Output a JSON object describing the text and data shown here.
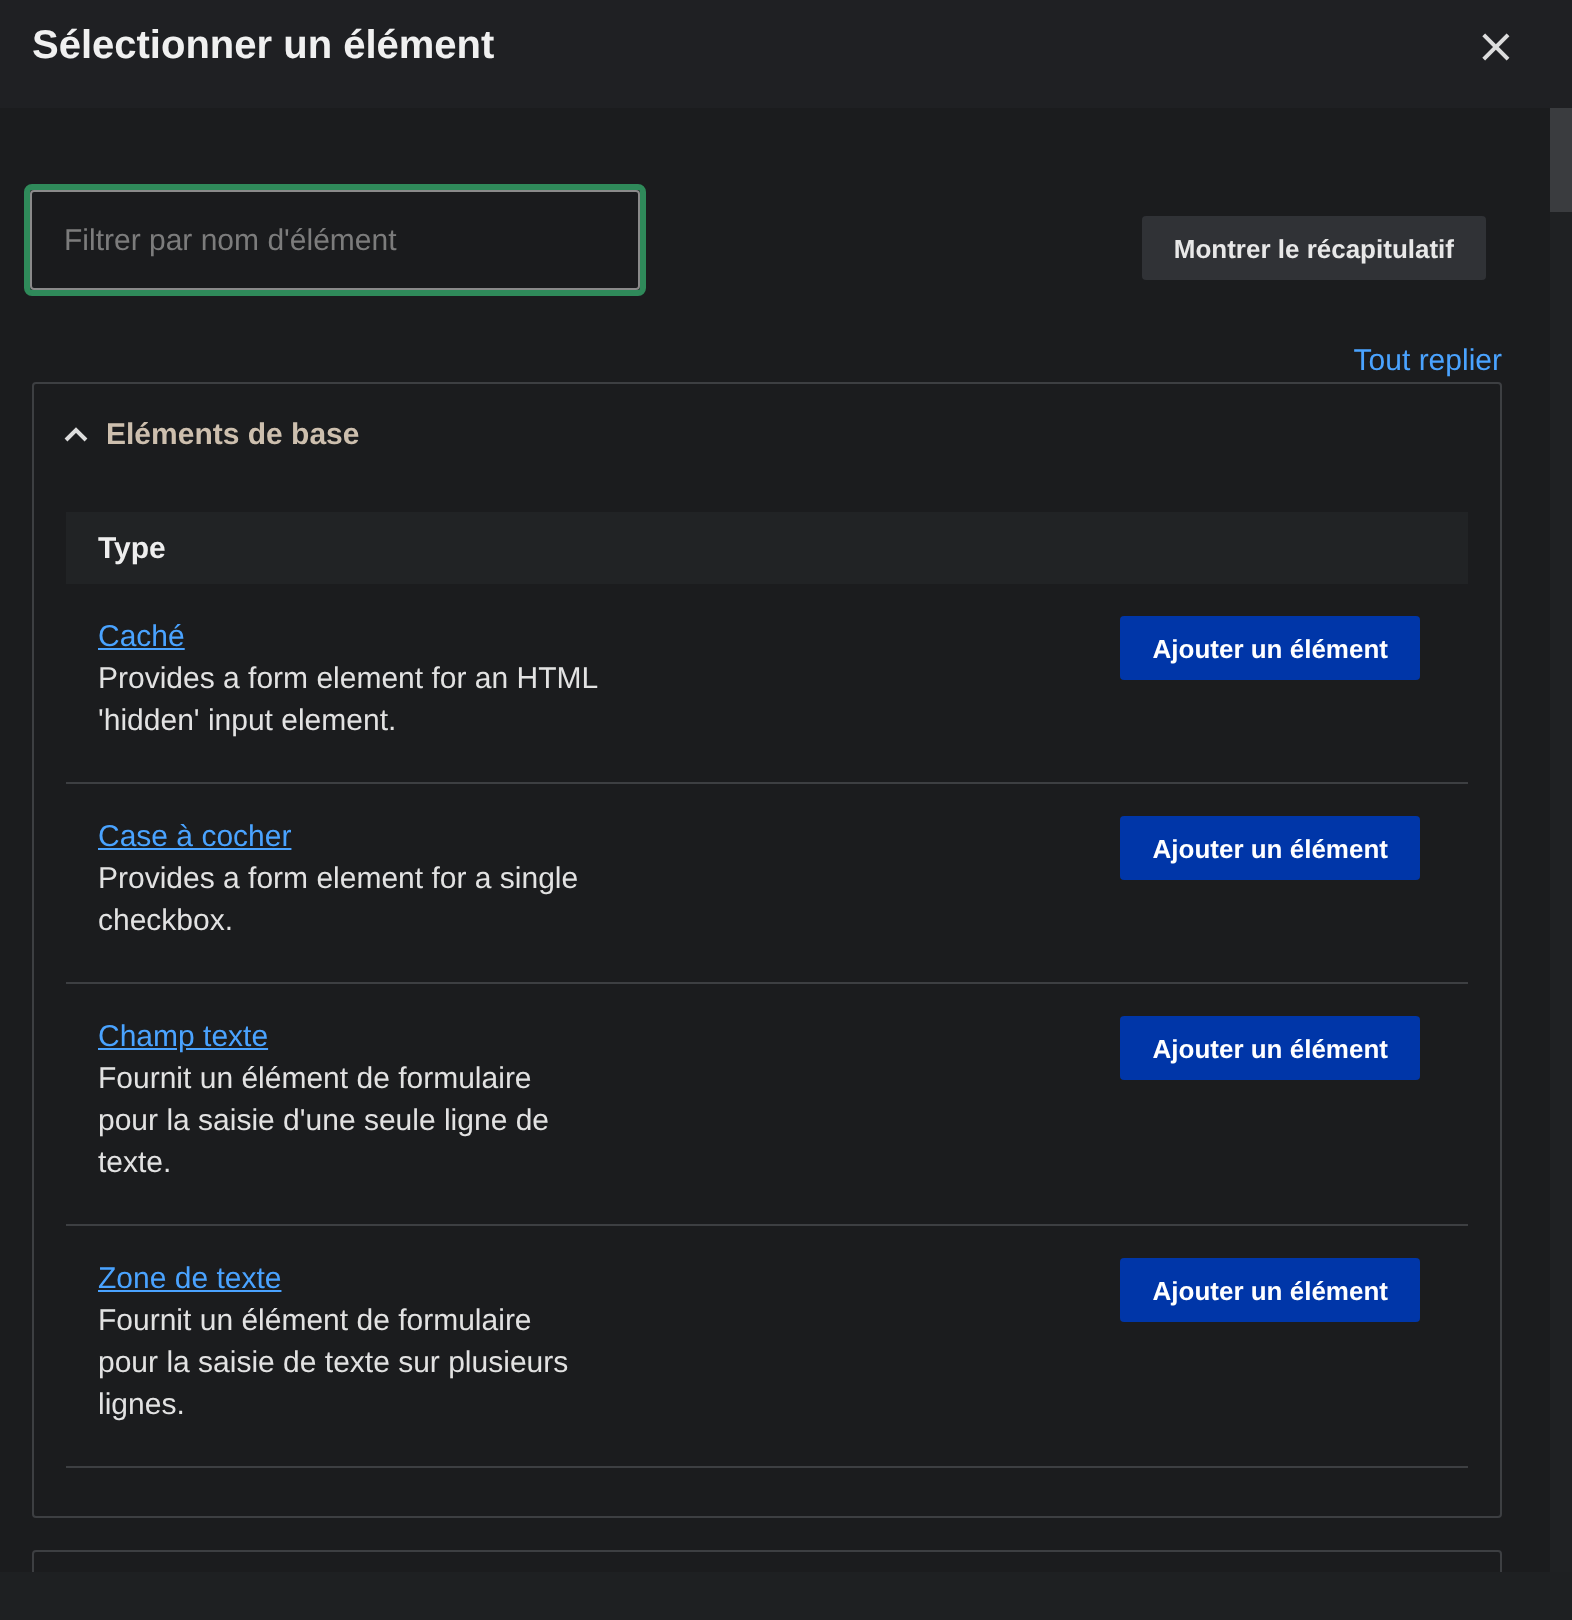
{
  "dialog": {
    "title": "Sélectionner un élément",
    "close_label": "×"
  },
  "search": {
    "placeholder": "Filtrer par nom d'élément",
    "focused": true
  },
  "summary_button": "Montrer le récapitulatif",
  "collapse_link": "Tout replier",
  "sections": [
    {
      "title": "Eléments de base",
      "expanded": true,
      "column": "Type",
      "rows": [
        {
          "name": "Caché",
          "description": "Provides a form element for an HTML 'hidden' input element.",
          "action": "Ajouter un élément"
        },
        {
          "name": "Case à cocher",
          "description": "Provides a form element for a single checkbox.",
          "action": "Ajouter un élément"
        },
        {
          "name": "Champ texte",
          "description": "Fournit un élément de formulaire pour la saisie d'une seule ligne de texte.",
          "action": "Ajouter un élément"
        },
        {
          "name": "Zone de texte",
          "description": "Fournit un élément de formulaire pour la saisie de texte sur plusieurs lignes.",
          "action": "Ajouter un élément"
        }
      ]
    },
    {
      "expanded": false
    }
  ]
}
